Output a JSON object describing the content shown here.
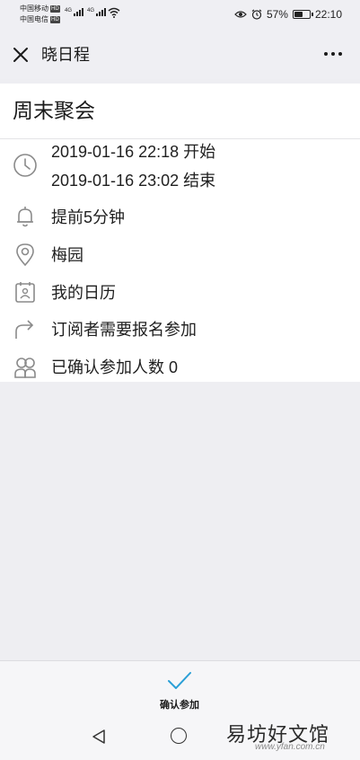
{
  "status_bar": {
    "carrier_1": "中国移动",
    "carrier_2": "中国电信",
    "hd_badge": "HD",
    "network_1": "4G",
    "network_2": "4G",
    "battery_percent": "57%",
    "battery_level": 0.57,
    "time": "22:10"
  },
  "header": {
    "title": "晓日程"
  },
  "event": {
    "title": "周末聚会",
    "start": "2019-01-16 22:18 开始",
    "end": "2019-01-16 23:02 结束",
    "reminder": "提前5分钟",
    "location": "梅园",
    "calendar": "我的日历",
    "signup_rule": "订阅者需要报名参加",
    "confirmed_count": "已确认参加人数 0"
  },
  "bottom_bar": {
    "confirm_label": "确认参加"
  },
  "watermark": {
    "text": "易坊好文馆",
    "url": "www.yfan.com.cn"
  },
  "colors": {
    "accent": "#2a9fd6",
    "background": "#eeeef2",
    "card": "#ffffff"
  },
  "icons": [
    "close-icon",
    "more-icon",
    "clock-icon",
    "bell-icon",
    "location-pin-icon",
    "calendar-contact-icon",
    "share-arrow-icon",
    "people-icon",
    "checkmark-icon",
    "back-icon",
    "home-icon"
  ]
}
